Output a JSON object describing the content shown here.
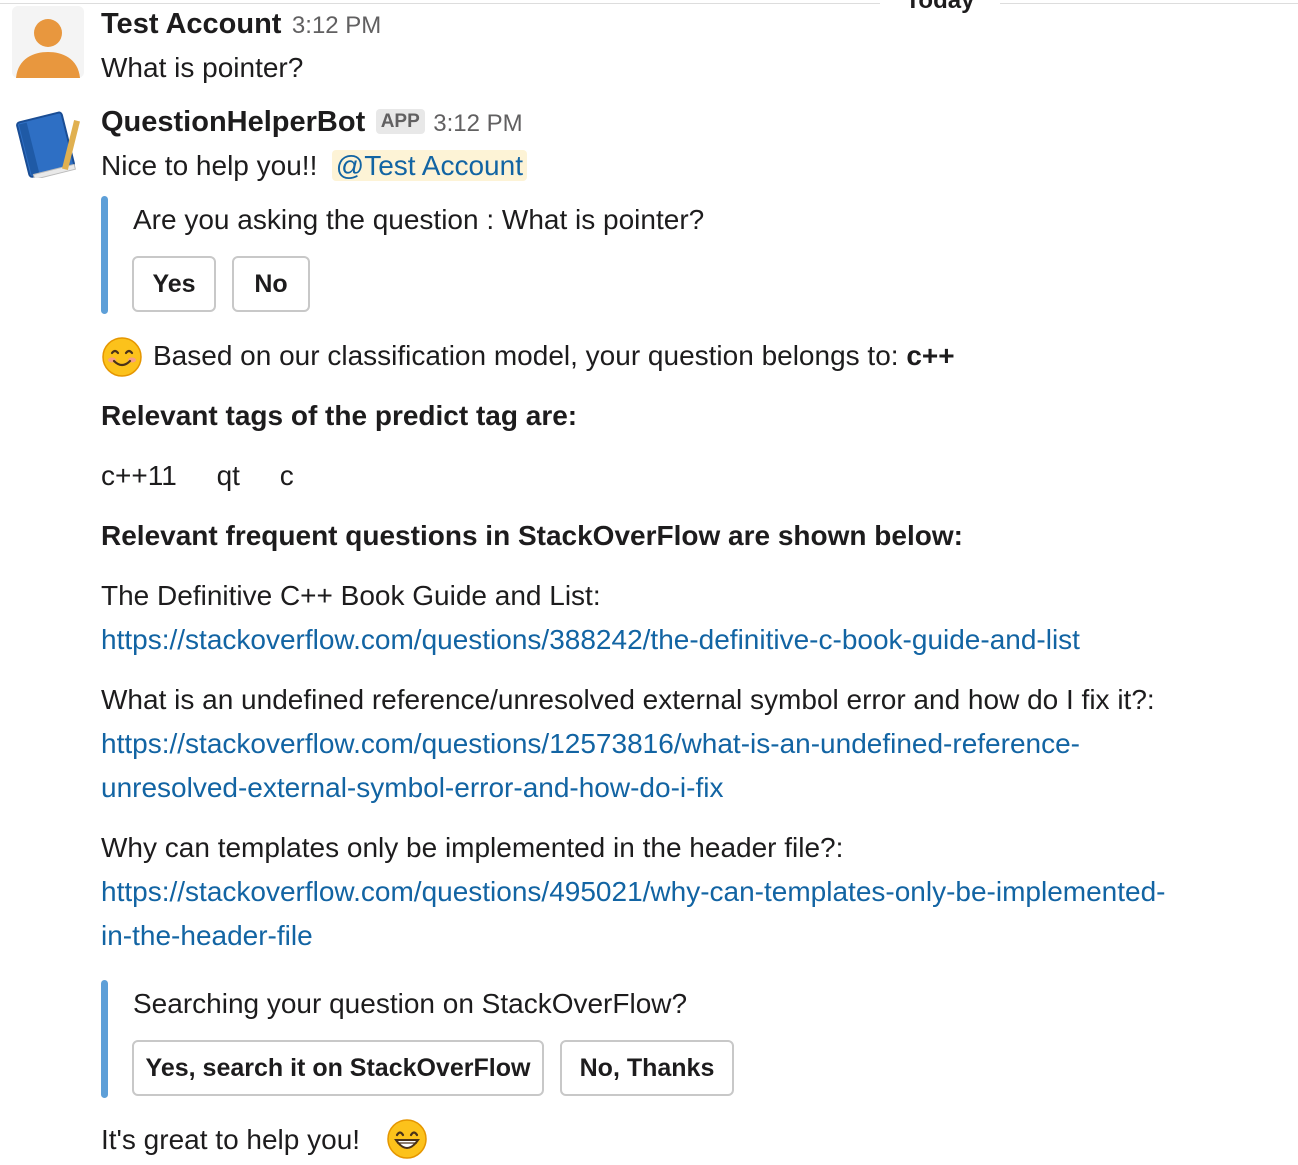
{
  "divider": {
    "label": "Today"
  },
  "user_message": {
    "author": "Test Account",
    "time": "3:12 PM",
    "text": "What is pointer?"
  },
  "bot_message": {
    "author": "QuestionHelperBot",
    "badge": "APP",
    "time": "3:12 PM",
    "greeting": "Nice to help you!!",
    "mention": "@Test Account",
    "confirm_attachment": {
      "text": "Are you asking the question : What is pointer?",
      "buttons": [
        "Yes",
        "No"
      ]
    },
    "classification_text": "Based on our classification model, your question belongs to:",
    "classification_tag": "c++",
    "tags_heading": "Relevant tags of the predict tag are:",
    "tags": [
      "c++11",
      "qt",
      "c"
    ],
    "questions_heading": "Relevant frequent questions in StackOverFlow are shown below:",
    "questions": [
      {
        "title": "The Definitive C++ Book Guide and List:",
        "link_lines": [
          "https://stackoverflow.com/questions/388242/the-definitive-c-book-guide-and-list"
        ]
      },
      {
        "title": "What is an undefined reference/unresolved external symbol error and how do I fix it?:",
        "link_lines": [
          "https://stackoverflow.com/questions/12573816/what-is-an-undefined-reference-",
          "unresolved-external-symbol-error-and-how-do-i-fix"
        ]
      },
      {
        "title": "Why can templates only be implemented in the header file?:",
        "link_lines": [
          "https://stackoverflow.com/questions/495021/why-can-templates-only-be-implemented-",
          "in-the-header-file"
        ]
      }
    ],
    "search_attachment": {
      "text": "Searching your question on StackOverFlow?",
      "buttons": [
        "Yes, search it on StackOverFlow",
        "No, Thanks"
      ]
    },
    "closing": "It's great to help you!"
  },
  "colors": {
    "link": "#1264a3",
    "attachment_bar": "#5d9fd8",
    "mention_bg": "#fdf3d6"
  },
  "icons": {
    "user_avatar": "person-avatar-icon",
    "bot_avatar": "blue-book-icon",
    "smile": "smiling-face-emoji",
    "grin": "grinning-face-emoji"
  }
}
